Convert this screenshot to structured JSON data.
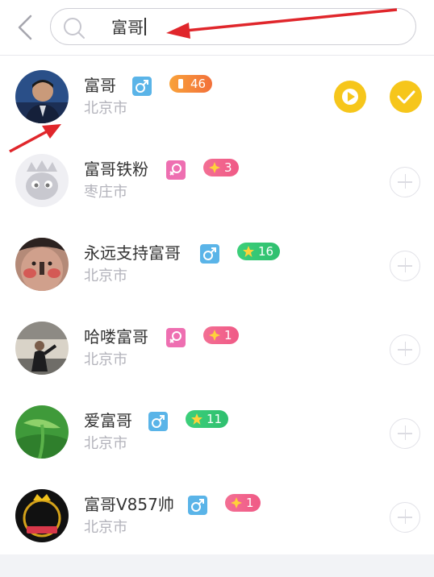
{
  "search": {
    "query": "富哥"
  },
  "colors": {
    "accent_yellow": "#f6c61b",
    "male": "#5ab4e8",
    "female": "#ee6fb1",
    "level_orange": "#f2703a",
    "level_pink": "#f05a86",
    "level_green": "#2fbf6f",
    "annotation_red": "#e0262b"
  },
  "results": [
    {
      "name": "富哥",
      "city": "北京市",
      "gender": "male",
      "level": "46",
      "level_style": "orange",
      "action": "followed"
    },
    {
      "name": "富哥铁粉",
      "city": "枣庄市",
      "gender": "female",
      "level": "3",
      "level_style": "pink",
      "action": "add"
    },
    {
      "name": "永远支持富哥",
      "city": "北京市",
      "gender": "male",
      "level": "16",
      "level_style": "green",
      "action": "add"
    },
    {
      "name": "哈喽富哥",
      "city": "北京市",
      "gender": "female",
      "level": "1",
      "level_style": "pink",
      "action": "add"
    },
    {
      "name": "爱富哥",
      "city": "北京市",
      "gender": "male",
      "level": "11",
      "level_style": "green",
      "action": "add"
    },
    {
      "name": "富哥V857帅",
      "city": "北京市",
      "gender": "male",
      "level": "1",
      "level_style": "pink",
      "action": "add"
    }
  ]
}
